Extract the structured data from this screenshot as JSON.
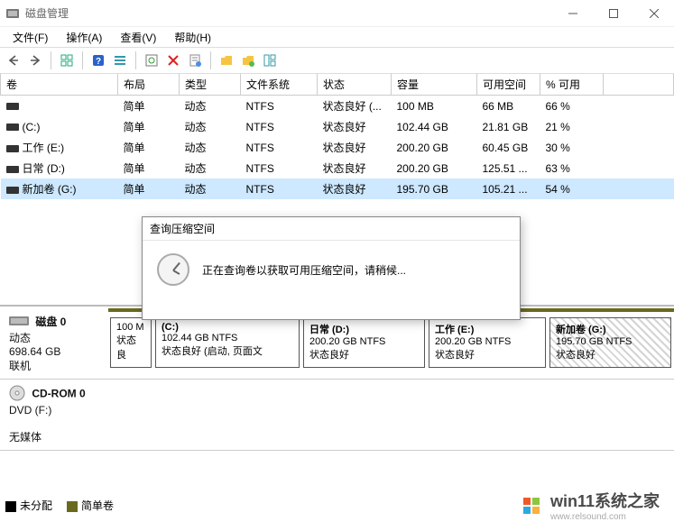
{
  "window": {
    "title": "磁盘管理"
  },
  "menus": {
    "file": "文件(F)",
    "action": "操作(A)",
    "view": "查看(V)",
    "help": "帮助(H)"
  },
  "columns": {
    "c0": "卷",
    "c1": "布局",
    "c2": "类型",
    "c3": "文件系统",
    "c4": "状态",
    "c5": "容量",
    "c6": "可用空间",
    "c7": "% 可用"
  },
  "rows": [
    {
      "name": "",
      "layout": "简单",
      "type": "动态",
      "fs": "NTFS",
      "state": "状态良好 (...",
      "cap": "100 MB",
      "free": "66 MB",
      "pct": "66 %"
    },
    {
      "name": "(C:)",
      "layout": "简单",
      "type": "动态",
      "fs": "NTFS",
      "state": "状态良好",
      "cap": "102.44 GB",
      "free": "21.81 GB",
      "pct": "21 %"
    },
    {
      "name": "工作 (E:)",
      "layout": "简单",
      "type": "动态",
      "fs": "NTFS",
      "state": "状态良好",
      "cap": "200.20 GB",
      "free": "60.45 GB",
      "pct": "30 %"
    },
    {
      "name": "日常 (D:)",
      "layout": "简单",
      "type": "动态",
      "fs": "NTFS",
      "state": "状态良好",
      "cap": "200.20 GB",
      "free": "125.51 ...",
      "pct": "63 %"
    },
    {
      "name": "新加卷 (G:)",
      "layout": "简单",
      "type": "动态",
      "fs": "NTFS",
      "state": "状态良好",
      "cap": "195.70 GB",
      "free": "105.21 ...",
      "pct": "54 %"
    }
  ],
  "disk0": {
    "title": "磁盘 0",
    "type": "动态",
    "size": "698.64 GB",
    "status": "联机",
    "parts": [
      {
        "title": "",
        "line2": "100 M",
        "line3": "状态良"
      },
      {
        "title": "(C:)",
        "line2": "102.44 GB NTFS",
        "line3": "状态良好 (启动, 页面文"
      },
      {
        "title": "日常  (D:)",
        "line2": "200.20 GB NTFS",
        "line3": "状态良好"
      },
      {
        "title": "工作  (E:)",
        "line2": "200.20 GB NTFS",
        "line3": "状态良好"
      },
      {
        "title": "新加卷  (G:)",
        "line2": "195.70 GB NTFS",
        "line3": "状态良好"
      }
    ]
  },
  "cdrom": {
    "title": "CD-ROM 0",
    "line2": "DVD (F:)",
    "line3": "无媒体"
  },
  "legend": {
    "unalloc": "未分配",
    "simple": "简单卷"
  },
  "dialog": {
    "title": "查询压缩空间",
    "msg": "正在查询卷以获取可用压缩空间，请稍候..."
  },
  "watermark": {
    "brand": "win11系统之家",
    "url": "www.relsound.com"
  }
}
